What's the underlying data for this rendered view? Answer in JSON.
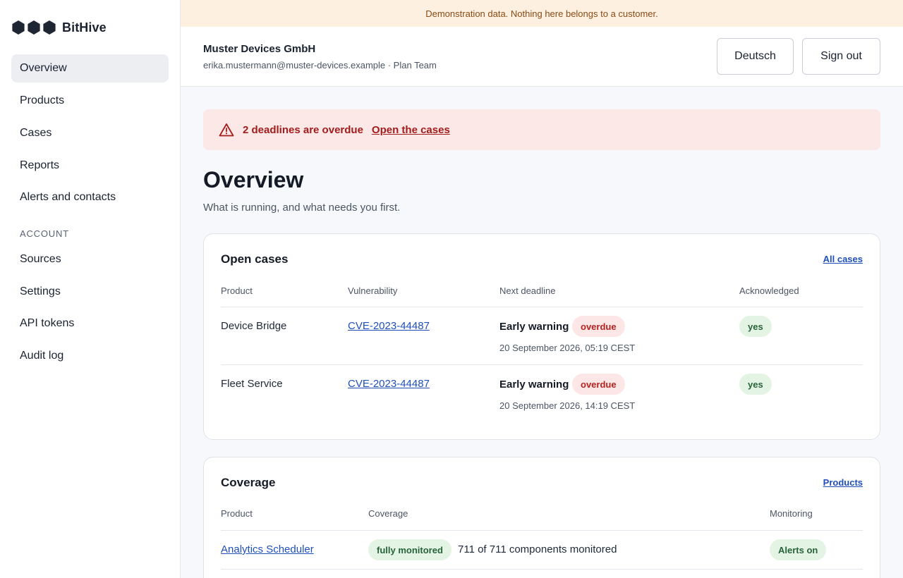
{
  "app": {
    "name": "BitHive"
  },
  "sidebar": {
    "items": [
      {
        "label": "Overview",
        "active": true
      },
      {
        "label": "Products"
      },
      {
        "label": "Cases"
      },
      {
        "label": "Reports"
      },
      {
        "label": "Alerts and contacts"
      }
    ],
    "account_heading": "ACCOUNT",
    "account_items": [
      {
        "label": "Sources"
      },
      {
        "label": "Settings"
      },
      {
        "label": "API tokens"
      },
      {
        "label": "Audit log"
      }
    ]
  },
  "banner": {
    "text": "Demonstration data. Nothing here belongs to a customer."
  },
  "header": {
    "org_name": "Muster Devices GmbH",
    "org_sub": "erika.mustermann@muster-devices.example · Plan Team",
    "language_button": "Deutsch",
    "signout_button": "Sign out"
  },
  "alert": {
    "text": "2 deadlines are overdue",
    "link": "Open the cases",
    "icon": "warning-triangle-icon",
    "color": "#a31c1c"
  },
  "page": {
    "title": "Overview",
    "subtitle": "What is running, and what needs you first."
  },
  "open_cases": {
    "title": "Open cases",
    "link": "All cases",
    "columns": [
      "Product",
      "Vulnerability",
      "Next deadline",
      "Acknowledged"
    ],
    "rows": [
      {
        "product": "Device Bridge",
        "vulnerability": "CVE-2023-44487",
        "deadline_label": "Early warning",
        "deadline_status": "overdue",
        "deadline_date": "20 September 2026, 05:19 CEST",
        "acknowledged": "yes"
      },
      {
        "product": "Fleet Service",
        "vulnerability": "CVE-2023-44487",
        "deadline_label": "Early warning",
        "deadline_status": "overdue",
        "deadline_date": "20 September 2026, 14:19 CEST",
        "acknowledged": "yes"
      }
    ]
  },
  "coverage": {
    "title": "Coverage",
    "link": "Products",
    "columns": [
      "Product",
      "Coverage",
      "Monitoring"
    ],
    "rows": [
      {
        "product": "Analytics Scheduler",
        "coverage_status": "fully monitored",
        "coverage_text": "711 of 711 components monitored",
        "monitoring": "Alerts on"
      }
    ]
  }
}
